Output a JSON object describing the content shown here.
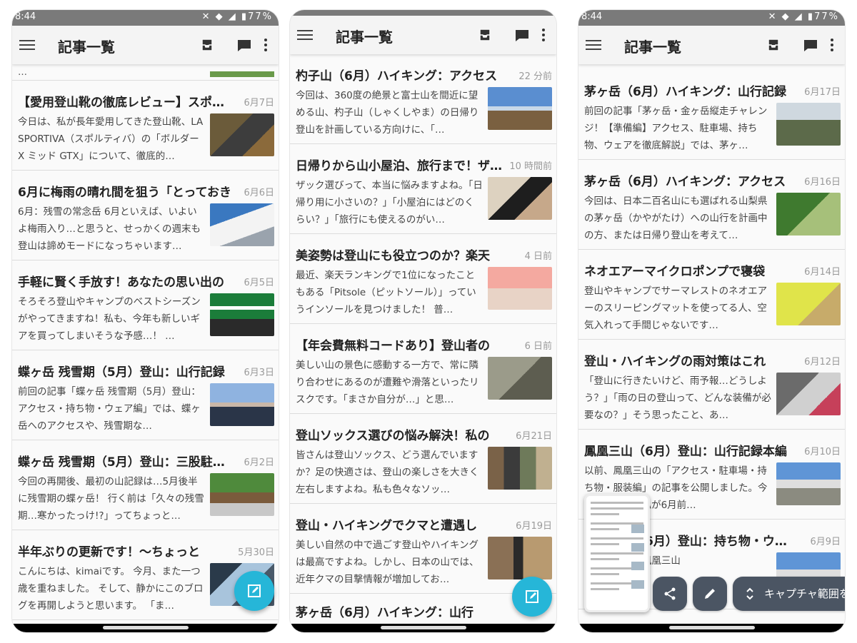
{
  "app_title": "記事一覧",
  "status": {
    "time": "8:44",
    "battery": "77%"
  },
  "phones": [
    {
      "partial_top": "…",
      "items": [
        {
          "title": "【愛用登山靴の徹底レビュー】スポルティバ",
          "date": "6月7日",
          "excerpt": "今日は、私が長年愛用してきた登山靴、LA SPORTIVA（スポルティバ）の「ボルダーX ミッド GTX」について、徹底的…",
          "thumb": "g-boots"
        },
        {
          "title": "6月に梅雨の晴れ間を狙う「とっておき",
          "date": "6月6日",
          "excerpt": "6月：残雪の常念岳 6月といえば、いよいよ梅雨入り…と思うと、せっかくの週末も登山は諦めモードになっちゃいます…",
          "thumb": "g-snow"
        },
        {
          "title": "手軽に賢く手放す！あなたの思い出の",
          "date": "6月5日",
          "excerpt": "そろそろ登山やキャンプのベストシーズンがやってきますね！私も、今年も新しいギアを買ってしまいそうな予感…！ …",
          "thumb": "g-sign"
        },
        {
          "title": "蝶ヶ岳 残雪期（5月）登山：山行記録",
          "date": "6月3日",
          "excerpt": "前回の記事「蝶ヶ岳 残雪期（5月）登山：アクセス・持ち物・ウェア編」では、蝶ヶ岳へのアクセスや、残雪期な…",
          "thumb": "g-dusk"
        },
        {
          "title": "蝶ヶ岳 残雪期（5月）登山：三股駐車場",
          "date": "6月2日",
          "excerpt": "今回の再開後、最初の山記録は…5月後半に残雪期の蝶ヶ岳！ 行く前は「久々の残雪期…寒かったっけ!?」ってちょっと…",
          "thumb": "g-hut"
        },
        {
          "title": "半年ぶりの更新です！〜ちょっと",
          "date": "5月30日",
          "excerpt": "こんにちは、kimaiです。 今月、また一つ歳を重ねました。 そして、静かにこのブログを再開しようと思います。 「ま…",
          "thumb": "g-ice"
        }
      ]
    },
    {
      "items": [
        {
          "title": "杓子山（6月）ハイキング：アクセス",
          "date": "22 分前",
          "excerpt": "今回は、360度の絶景と富士山を間近に望める山、杓子山（しゃくしやま）の日帰り登山を計画している方向けに、「…",
          "thumb": "g-fuji"
        },
        {
          "title": "日帰りから山小屋泊、旅行まで！ザック",
          "date": "10 時間前",
          "excerpt": "ザック選びって、本当に悩みますよね。「日帰り用に小さいの？」「小屋泊にはどのくらい？」「旅行にも使えるのがい…",
          "thumb": "g-bag"
        },
        {
          "title": "美姿勢は登山にも役立つのか？楽天",
          "date": "4 日前",
          "excerpt": "最近、楽天ランキングで1位になったこともある「Pitsole（ピットソール）」っていうインソールを見つけました！ 普…",
          "thumb": "g-pink"
        },
        {
          "title": "【年会費無料コードあり】登山者の",
          "date": "6 日前",
          "excerpt": "美しい山の景色に感動する一方で、常に隣り合わせにあるのが遭難や滑落といったリスクです。「まさか自分が…」と思…",
          "thumb": "g-pack"
        },
        {
          "title": "登山ソックス選びの悩み解決！私の",
          "date": "6月21日",
          "excerpt": "皆さんは登山ソックス、どう選んでいますか？足の快適さは、登山の楽しさを大きく左右しますよね。私も色々なソッ…",
          "thumb": "g-sock"
        },
        {
          "title": "登山・ハイキングでクマと遭遇し",
          "date": "6月19日",
          "excerpt": "美しい自然の中で過ごす登山やハイキングは最高ですよね。しかし、日本の山では、近年クマの目撃情報が増加してお…",
          "thumb": "g-spray"
        }
      ],
      "partial_bottom": "茅ヶ岳（6月）ハイキング：山行"
    },
    {
      "items": [
        {
          "title": "茅ヶ岳（6月）ハイキング：山行記録",
          "date": "6月17日",
          "excerpt": "前回の記事「茅ヶ岳・金ヶ岳縦走チャレンジ！【準備編】アクセス、駐車場、持ち物、ウェアを徹底解説」では、茅ヶ…",
          "thumb": "g-summit"
        },
        {
          "title": "茅ヶ岳（6月）ハイキング：アクセス",
          "date": "6月16日",
          "excerpt": "今回は、日本二百名山にも選ばれる山梨県の茅ヶ岳（かやがたけ）への山行を計画中の方、または日帰り登山を考えて…",
          "thumb": "g-forest"
        },
        {
          "title": "ネオエアーマイクロポンプで寝袋",
          "date": "6月14日",
          "excerpt": "登山やキャンプでサーマレストのネオエアーのスリーピングマットを使ってる人、空気入れって手間じゃないです…",
          "thumb": "g-yellow"
        },
        {
          "title": "登山・ハイキングの雨対策はこれ",
          "date": "6月12日",
          "excerpt": "「登山に行きたいけど、雨予報…どうしよう？」「雨の日の登山って、どんな装備が必要なの？」そう思ったこと、あ…",
          "thumb": "g-rain"
        },
        {
          "title": "鳳凰三山（6月）登山：山行記録本編",
          "date": "6月10日",
          "excerpt": "以前、鳳凰三山の「アクセス・駐車場・持ち物・服装編」の記事を公開しました。今回はついに、私が6月前…",
          "thumb": "g-rock"
        },
        {
          "title": "鳳凰三山（6月）登山：持ち物・ウェア",
          "date": "6月9日",
          "excerpt": "南アルプスの鳳凰三山",
          "thumb": "g-rock"
        }
      ],
      "capture_label": "キャプチャ範囲を"
    }
  ]
}
